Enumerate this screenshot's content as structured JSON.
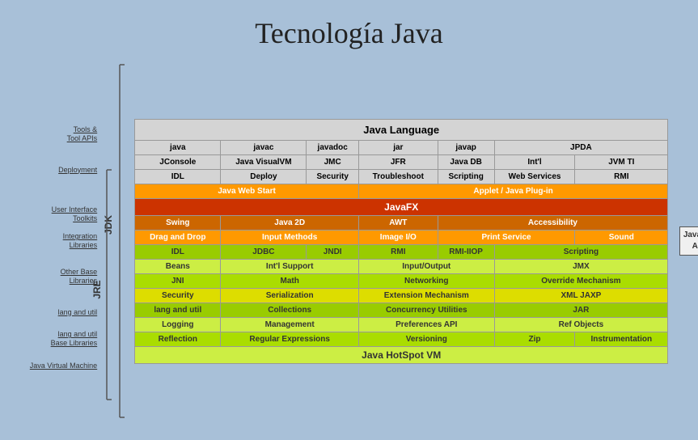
{
  "page": {
    "title": "Tecnología Java"
  },
  "diagram": {
    "jdk_label": "JDK",
    "jre_label": "JRE",
    "java_se_api_label": "Java SE\nAPI",
    "sections": {
      "java_language_header": "Java Language",
      "tools_label": "Tools &\nTool APIs",
      "deployment_label": "Deployment",
      "ui_toolkits_label": "User Interface\nToolkits",
      "integration_label": "Integration\nLibraries",
      "other_base_label": "Other Base\nLibraries",
      "lang_util_label": "lang and util",
      "lang_util_base_label": "lang and util\nBase Libraries",
      "jvm_label": "Java Virtual Machine"
    },
    "rows": [
      {
        "type": "header",
        "cells": [
          {
            "text": "Java Language",
            "colspan": 6,
            "color": "gray"
          }
        ]
      },
      {
        "type": "data",
        "cells": [
          {
            "text": "java",
            "color": "gray"
          },
          {
            "text": "javac",
            "color": "gray"
          },
          {
            "text": "javadoc",
            "color": "gray"
          },
          {
            "text": "jar",
            "color": "gray"
          },
          {
            "text": "javap",
            "color": "gray"
          },
          {
            "text": "JPDA",
            "color": "gray"
          }
        ]
      },
      {
        "type": "data",
        "cells": [
          {
            "text": "JConsole",
            "color": "gray"
          },
          {
            "text": "Java VisualVM",
            "color": "gray"
          },
          {
            "text": "JMC",
            "color": "gray"
          },
          {
            "text": "JFR",
            "color": "gray"
          },
          {
            "text": "Java DB",
            "color": "gray"
          },
          {
            "text": "Int'l",
            "color": "gray"
          },
          {
            "text": "JVM TI",
            "color": "gray"
          }
        ]
      },
      {
        "type": "data",
        "cells": [
          {
            "text": "IDL",
            "color": "gray"
          },
          {
            "text": "Deploy",
            "color": "gray"
          },
          {
            "text": "Security",
            "color": "gray"
          },
          {
            "text": "Troubleshoot",
            "color": "gray"
          },
          {
            "text": "Scripting",
            "color": "gray"
          },
          {
            "text": "Web Services",
            "color": "gray"
          },
          {
            "text": "RMI",
            "color": "gray"
          }
        ]
      },
      {
        "type": "deployment",
        "cells": [
          {
            "text": "Java Web Start",
            "colspan": 3,
            "color": "orange2"
          },
          {
            "text": "Applet / Java Plug-in",
            "colspan": 4,
            "color": "orange2"
          }
        ]
      },
      {
        "type": "javafx",
        "cells": [
          {
            "text": "JavaFX",
            "colspan": 7,
            "color": "red"
          }
        ]
      },
      {
        "type": "swing",
        "cells": [
          {
            "text": "Swing",
            "color": "orange1"
          },
          {
            "text": "Java 2D",
            "colspan": 2,
            "color": "orange1"
          },
          {
            "text": "AWT",
            "color": "orange1"
          },
          {
            "text": "Accessibility",
            "colspan": 2,
            "color": "orange1"
          }
        ]
      },
      {
        "type": "dnd",
        "cells": [
          {
            "text": "Drag and Drop",
            "color": "orange2"
          },
          {
            "text": "Input Methods",
            "color": "orange2"
          },
          {
            "text": "Image I/O",
            "color": "orange2"
          },
          {
            "text": "Print Service",
            "colspan": 2,
            "color": "orange2"
          },
          {
            "text": "Sound",
            "color": "orange2"
          }
        ]
      },
      {
        "type": "integration",
        "cells": [
          {
            "text": "IDL",
            "color": "green1"
          },
          {
            "text": "JDBC",
            "color": "green1"
          },
          {
            "text": "JNDI",
            "color": "green1"
          },
          {
            "text": "RMI",
            "color": "green1"
          },
          {
            "text": "RMI-IIOP",
            "color": "green1"
          },
          {
            "text": "Scripting",
            "colspan": 2,
            "color": "green1"
          }
        ]
      },
      {
        "type": "beans",
        "cells": [
          {
            "text": "Beans",
            "color": "green2"
          },
          {
            "text": "Int'l Support",
            "colspan": 2,
            "color": "green2"
          },
          {
            "text": "Input/Output",
            "colspan": 2,
            "color": "green2"
          },
          {
            "text": "JMX",
            "colspan": 2,
            "color": "green2"
          }
        ]
      },
      {
        "type": "jni",
        "cells": [
          {
            "text": "JNI",
            "color": "green3"
          },
          {
            "text": "Math",
            "colspan": 2,
            "color": "green3"
          },
          {
            "text": "Networking",
            "colspan": 2,
            "color": "green3"
          },
          {
            "text": "Override Mechanism",
            "colspan": 2,
            "color": "green3"
          }
        ]
      },
      {
        "type": "security",
        "cells": [
          {
            "text": "Security",
            "color": "yellow2"
          },
          {
            "text": "Serialization",
            "colspan": 2,
            "color": "yellow2"
          },
          {
            "text": "Extension Mechanism",
            "colspan": 2,
            "color": "yellow2"
          },
          {
            "text": "XML JAXP",
            "colspan": 2,
            "color": "yellow2"
          }
        ]
      },
      {
        "type": "lang_util",
        "cells": [
          {
            "text": "lang and util",
            "color": "green1"
          },
          {
            "text": "Collections",
            "colspan": 2,
            "color": "green1"
          },
          {
            "text": "Concurrency Utilities",
            "colspan": 2,
            "color": "green1"
          },
          {
            "text": "JAR",
            "colspan": 2,
            "color": "green1"
          }
        ]
      },
      {
        "type": "logging",
        "cells": [
          {
            "text": "Logging",
            "color": "green2"
          },
          {
            "text": "Management",
            "colspan": 2,
            "color": "green2"
          },
          {
            "text": "Preferences API",
            "colspan": 2,
            "color": "green2"
          },
          {
            "text": "Ref Objects",
            "colspan": 2,
            "color": "green2"
          }
        ]
      },
      {
        "type": "reflection",
        "cells": [
          {
            "text": "Reflection",
            "color": "green3"
          },
          {
            "text": "Regular Expressions",
            "colspan": 2,
            "color": "green3"
          },
          {
            "text": "Versioning",
            "colspan": 2,
            "color": "green3"
          },
          {
            "text": "Zip",
            "color": "green3"
          },
          {
            "text": "Instrumentation",
            "color": "green3"
          }
        ]
      },
      {
        "type": "jvm",
        "cells": [
          {
            "text": "Java HotSpot VM",
            "colspan": 7,
            "color": "green2"
          }
        ]
      }
    ]
  }
}
